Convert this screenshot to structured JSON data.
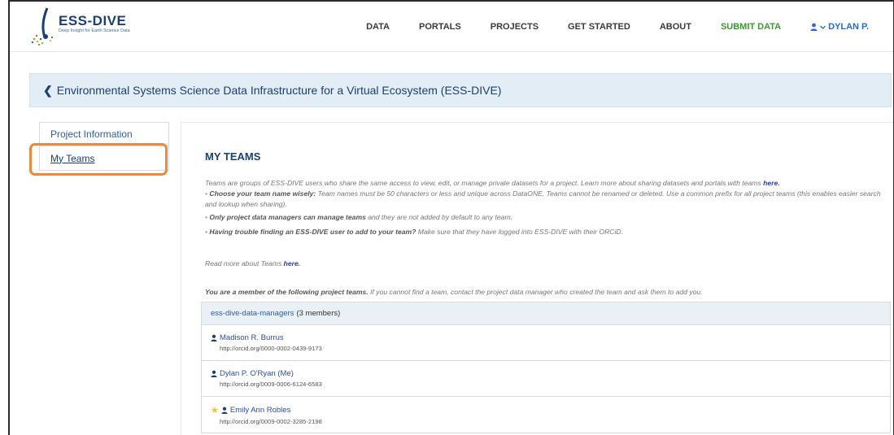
{
  "header": {
    "logo_title": "ESS-DIVE",
    "logo_subtitle": "Deep Insight for Earth Science Data",
    "nav": [
      {
        "label": "DATA"
      },
      {
        "label": "PORTALS"
      },
      {
        "label": "PROJECTS"
      },
      {
        "label": "GET STARTED"
      },
      {
        "label": "ABOUT"
      },
      {
        "label": "SUBMIT DATA"
      }
    ],
    "user_label": "DYLAN P."
  },
  "banner": {
    "chevron": "❮",
    "project_title": "Environmental Systems Science Data Infrastructure for a Virtual Ecosystem (ESS-DIVE)"
  },
  "sidebar": {
    "items": [
      {
        "label": "Project Information"
      },
      {
        "label": "My Teams"
      }
    ]
  },
  "main": {
    "title": "MY TEAMS",
    "intro_text": "Teams are groups of ESS-DIVE users who share the same access to view, edit, or manage private datasets for a project. Learn more about sharing datasets and portals with teams ",
    "intro_link": "here.",
    "bullets": [
      {
        "bold": "Choose your team name wisely:",
        "text": " Team names must be 50 characters or less and unique across DataONE. Teams cannot be renamed or deleted. Use a common prefix for all project teams (this enables easier search and lookup when sharing)."
      },
      {
        "bold": "Only project data managers can manage teams",
        "text": " and they are not added by default to any team."
      },
      {
        "bold": "Having trouble finding an ESS-DIVE user to add to your team?",
        "text": " Make sure that they have logged into ESS-DIVE with their ORCiD."
      }
    ],
    "read_more_text": "Read more about Teams ",
    "read_more_link": "here.",
    "member_intro_bold": "You are a member of the following project teams.",
    "member_intro_text": " If you cannot find a team, contact the project data manager who created the team and ask them to add you.",
    "team": {
      "name": "ess-dive-data-managers",
      "count": "(3 members)",
      "members": [
        {
          "name": "Madison R. Burrus",
          "orcid": "http://orcid.org/0000-0002-0439-9173",
          "starred": false
        },
        {
          "name": "Dylan P. O'Ryan (Me)",
          "orcid": "http://orcid.org/0009-0006-6124-6583",
          "starred": false
        },
        {
          "name": "Emily Ann Robles",
          "orcid": "http://orcid.org/0009-0002-3285-2198",
          "starred": true
        }
      ]
    }
  },
  "colors": {
    "brand_blue": "#1a3f73",
    "link_blue": "#2a5ea8",
    "submit_green": "#3a9a2d",
    "highlight_orange": "#f0883a",
    "banner_bg": "#e2edf6"
  },
  "icons": {
    "user": "user-icon",
    "star": "star-icon",
    "chevron": "chevron-left-icon"
  }
}
